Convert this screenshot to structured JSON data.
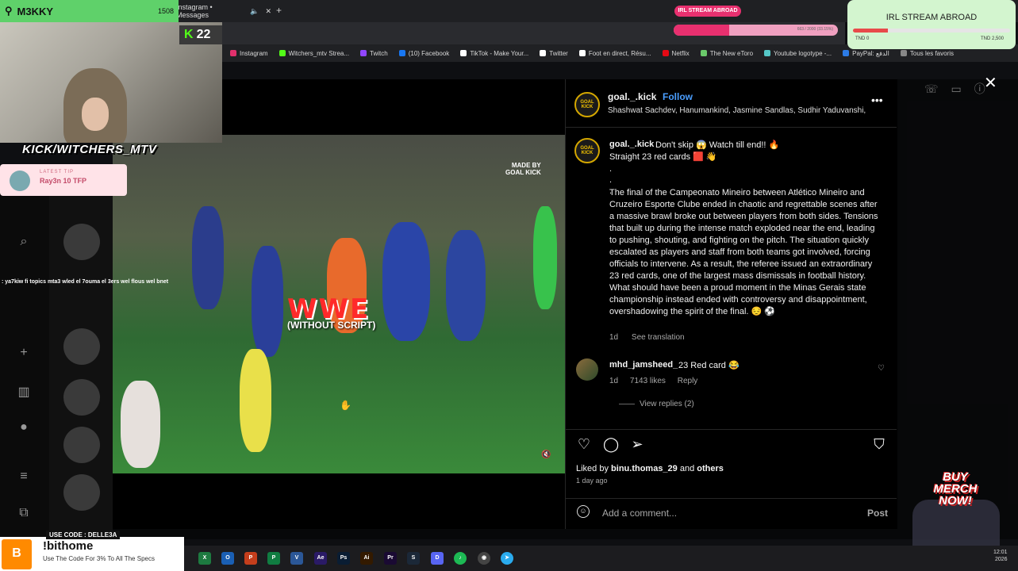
{
  "browser": {
    "tab_title": "Instagram • Messages",
    "bookmarks": [
      {
        "label": "Instagram",
        "color": "#e1306c"
      },
      {
        "label": "Witchers_mtv Strea...",
        "color": "#53fc18"
      },
      {
        "label": "Twitch",
        "color": "#9146ff"
      },
      {
        "label": "(10) Facebook",
        "color": "#1877f2"
      },
      {
        "label": "TikTok - Make Your...",
        "color": "#ffffff"
      },
      {
        "label": "Twitter",
        "color": "#ffffff"
      },
      {
        "label": "Foot en direct, Résu...",
        "color": "#ffffff"
      },
      {
        "label": "Netflix",
        "color": "#e50914"
      },
      {
        "label": "The New eToro",
        "color": "#6ac96a"
      },
      {
        "label": "Youtube logotype -...",
        "color": "#55c7c7"
      },
      {
        "label": "PayPal: الدفع",
        "color": "#2c7be5"
      },
      {
        "label": "Tous les favoris",
        "color": "#888888"
      }
    ]
  },
  "stream": {
    "streamer_name": "M3KKY",
    "viewer_count": "1508",
    "kick_count": "22",
    "kick_handle": "KICK/WITCHERS_MTV",
    "latest_tip_label": "LATEST TIP",
    "latest_tip": "Ray3n 10 TFP",
    "chat_message": ": ya7kiw fi topics mta3 wled el 7ouma el 3ers wel flous wel bnet",
    "irl_small": "IRL STREAM ABROAD",
    "goal_progress": 0.34,
    "goal_text": "663 / 2000 (33.15%)",
    "irl_card_title": "IRL STREAM ABROAD",
    "irl_progress": 0.22,
    "irl_min": "TND 0",
    "irl_max": "TND 2,500",
    "merch": "BUY MERCH NOW!",
    "promo_code": "USE CODE : DELLE3A",
    "promo_title": "!bithome",
    "promo_sub": "Use The Code For 3% To All The Specs"
  },
  "post": {
    "video": {
      "headline": "WWE",
      "subline": "(WITHOUT SCRIPT)",
      "watermark": "MADE BY\nGOAL KICK"
    },
    "avatar_text": "GOAL KICK",
    "username": "goal._.kick",
    "follow_label": "Follow",
    "audio": "Shashwat Sachdev, Hanumankind, Jasmine Sandlas, Sudhir Yaduvanshi, C",
    "caption_first": "Don't skip 😱 Watch till end!! 🔥",
    "caption_second": "Straight 23 red cards 🟥 👋",
    "caption_dots": ".\n.\n.",
    "caption_body": "The final of the Campeonato Mineiro between Atlético Mineiro and Cruzeiro Esporte Clube ended in chaotic and regrettable scenes after a massive brawl broke out between players from both sides. Tensions that built up during the intense match exploded near the end, leading to pushing, shouting, and fighting on the pitch. The situation quickly escalated as players and staff from both teams got involved, forcing officials to intervene. As a result, the referee issued an extraordinary 23 red cards, one of the largest mass dismissals in football history. What should have been a proud moment in the Minas Gerais state championship instead ended with controversy and disappointment, overshadowing the spirit of the final. 😔 ⚽",
    "caption_age": "1d",
    "see_translation": "See translation",
    "comment": {
      "username": "mhd_jamsheed_",
      "text": "23 Red card 😂",
      "age": "1d",
      "likes": "7143 likes",
      "reply": "Reply",
      "view_replies": "View replies (2)"
    },
    "liked_by_prefix": "Liked by",
    "liked_by_user": "binu.thomas_29",
    "liked_by_and": "and",
    "liked_by_others": "others",
    "time_ago": "1 day ago",
    "add_comment_placeholder": "Add a comment...",
    "post_button": "Post"
  },
  "taskbar": {
    "time": "12:01",
    "date": "2026"
  }
}
